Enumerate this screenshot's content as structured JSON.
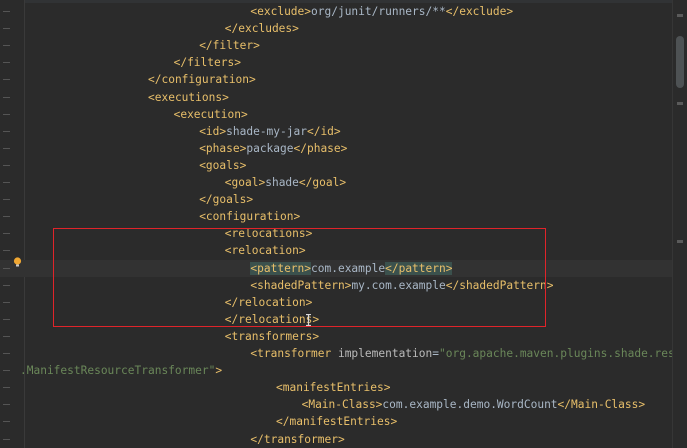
{
  "editor": {
    "lines": [
      {
        "indent": 9,
        "parts": [
          [
            "tag",
            "<exclude>"
          ],
          [
            "txt",
            "org/junit/runners/**"
          ],
          [
            "tag",
            "</exclude>"
          ]
        ]
      },
      {
        "indent": 8,
        "parts": [
          [
            "tag",
            "</excludes>"
          ]
        ]
      },
      {
        "indent": 7,
        "parts": [
          [
            "tag",
            "</filter>"
          ]
        ]
      },
      {
        "indent": 6,
        "parts": [
          [
            "tag",
            "</filters>"
          ]
        ]
      },
      {
        "indent": 5,
        "parts": [
          [
            "tag",
            "</configuration>"
          ]
        ]
      },
      {
        "indent": 5,
        "parts": [
          [
            "tag",
            "<executions>"
          ]
        ]
      },
      {
        "indent": 6,
        "parts": [
          [
            "tag",
            "<execution>"
          ]
        ]
      },
      {
        "indent": 7,
        "parts": [
          [
            "tag",
            "<id>"
          ],
          [
            "txt",
            "shade-my-jar"
          ],
          [
            "tag",
            "</id>"
          ]
        ]
      },
      {
        "indent": 7,
        "parts": [
          [
            "tag",
            "<phase>"
          ],
          [
            "txt",
            "package"
          ],
          [
            "tag",
            "</phase>"
          ]
        ]
      },
      {
        "indent": 7,
        "parts": [
          [
            "tag",
            "<goals>"
          ]
        ]
      },
      {
        "indent": 8,
        "parts": [
          [
            "tag",
            "<goal>"
          ],
          [
            "txt",
            "shade"
          ],
          [
            "tag",
            "</goal>"
          ]
        ]
      },
      {
        "indent": 7,
        "parts": [
          [
            "tag",
            "</goals>"
          ]
        ]
      },
      {
        "indent": 7,
        "parts": [
          [
            "tag",
            "<configuration>"
          ]
        ]
      },
      {
        "indent": 8,
        "parts": [
          [
            "tag",
            "<relocations>"
          ]
        ]
      },
      {
        "indent": 8,
        "parts": [
          [
            "tag",
            "<relocation>"
          ]
        ]
      },
      {
        "indent": 9,
        "caret": true,
        "parts": [
          [
            "tag-hl",
            "<pattern>"
          ],
          [
            "txt",
            "com.example"
          ],
          [
            "tag-hl",
            "</pattern>"
          ]
        ]
      },
      {
        "indent": 9,
        "parts": [
          [
            "tag",
            "<shadedPattern>"
          ],
          [
            "txt",
            "my.com.example"
          ],
          [
            "tag",
            "</shadedPattern>"
          ]
        ]
      },
      {
        "indent": 8,
        "parts": [
          [
            "tag",
            "</relocation>"
          ]
        ]
      },
      {
        "indent": 8,
        "parts": [
          [
            "tag",
            "</relocations>"
          ]
        ]
      },
      {
        "indent": 8,
        "parts": [
          [
            "tag",
            "<transformers>"
          ]
        ]
      },
      {
        "indent": 9,
        "parts": [
          [
            "tag",
            "<transformer "
          ],
          [
            "attr",
            "implementation"
          ],
          [
            "txt",
            "="
          ],
          [
            "str",
            "\"org.apache.maven.plugins.shade.resource"
          ]
        ]
      },
      {
        "indent": 0,
        "parts": [
          [
            "str",
            ".ManifestResourceTransformer\""
          ],
          [
            "tag",
            ">"
          ]
        ]
      },
      {
        "indent": 10,
        "parts": [
          [
            "tag",
            "<manifestEntries>"
          ]
        ]
      },
      {
        "indent": 11,
        "parts": [
          [
            "tag",
            "<Main-Class>"
          ],
          [
            "txt",
            "com.example.demo.WordCount"
          ],
          [
            "tag",
            "</Main-Class>"
          ]
        ]
      },
      {
        "indent": 10,
        "parts": [
          [
            "tag",
            "</manifestEntries>"
          ]
        ]
      },
      {
        "indent": 9,
        "parts": [
          [
            "tag",
            "</transformer>"
          ]
        ]
      }
    ]
  },
  "colors": {
    "background": "#2b2b2b",
    "tag": "#e8bf6a",
    "text": "#a9b7c6",
    "string": "#6a8759",
    "highlight_box": "#e0242a"
  },
  "icons": {
    "gutter_hint": "lightbulb-icon",
    "mouse_cursor": "text-cursor-icon"
  }
}
